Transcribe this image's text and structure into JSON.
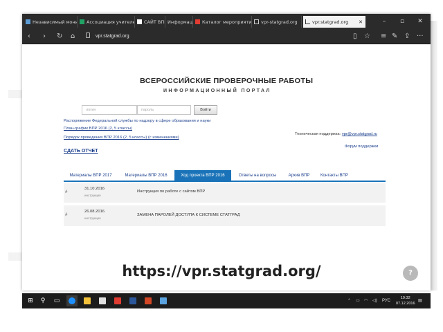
{
  "browser": {
    "tabs": [
      {
        "label": "Независимый мониторинг",
        "color": "#5b9bd5"
      },
      {
        "label": "Ассоциация учителей",
        "color": "#21a366"
      },
      {
        "label": "САЙТ ВПР",
        "color": "#ffffff"
      },
      {
        "label": "Информация",
        "color": "#888888"
      },
      {
        "label": "Каталог мероприятий",
        "color": "#e03c31"
      },
      {
        "label": "vpr-statgrad.org",
        "color": "#cccccc"
      },
      {
        "label": "vpr.statgrad.org",
        "color": "#333333",
        "active": true
      }
    ],
    "url": "vpr.statgrad.org"
  },
  "page": {
    "title": "ВСЕРОССИЙСКИЕ ПРОВЕРОЧНЫЕ РАБОТЫ",
    "subtitle": "ИНФОРМАЦИОННЫЙ ПОРТАЛ",
    "login": {
      "login_placeholder": "логин",
      "password_placeholder": "пароль",
      "button": "Войти"
    },
    "links": [
      "Распоряжение Федеральной службы по надзору в сфере образования и науки",
      "План-график ВПР 2016 (2, 5 классы)",
      "Порядок проведения ВПР 2016 (2, 5 классы) (с изменениями)"
    ],
    "report": "СДАТЬ ОТЧЕТ",
    "support_label": "Техническая поддержка:",
    "support_email": "vpr@vpr.statgrad.ru",
    "forum": "Форум поддержки",
    "tabs": [
      {
        "label": "Материалы ВПР 2017",
        "active": false
      },
      {
        "label": "Материалы ВПР 2016",
        "active": false
      },
      {
        "label": "Ход проекта ВПР 2016",
        "active": true
      },
      {
        "label": "Ответы на вопросы",
        "active": false
      },
      {
        "label": "Архив ВПР",
        "active": false
      },
      {
        "label": "Контакты ВПР",
        "active": false
      }
    ],
    "news": [
      {
        "num": "#",
        "date": "31.10.2016",
        "category": "инструкция",
        "title": "Инструкция по работе с сайтом ВПР"
      },
      {
        "num": "#",
        "date": "26.08.2016",
        "category": "инструкция",
        "title": "ЗАМЕНА ПАРОЛЕЙ ДОСТУПА К СИСТЕМЕ СТАТГРАД"
      }
    ]
  },
  "caption": "https://vpr.statgrad.org/",
  "taskbar": {
    "apps": [
      {
        "name": "windows",
        "color": "#ffffff"
      },
      {
        "name": "search",
        "color": "#ffffff"
      },
      {
        "name": "task-view",
        "color": "#ffffff"
      },
      {
        "name": "edge",
        "color": "#1e90ff"
      },
      {
        "name": "explorer",
        "color": "#f3c13a"
      },
      {
        "name": "store",
        "color": "#e0e0e0"
      },
      {
        "name": "pdf",
        "color": "#e03c31"
      },
      {
        "name": "word",
        "color": "#2b579a"
      },
      {
        "name": "powerpoint",
        "color": "#d24726"
      },
      {
        "name": "paint",
        "color": "#5ba3e0"
      }
    ],
    "lang": "РУС",
    "time": "19:32",
    "date": "07.12.2016"
  }
}
